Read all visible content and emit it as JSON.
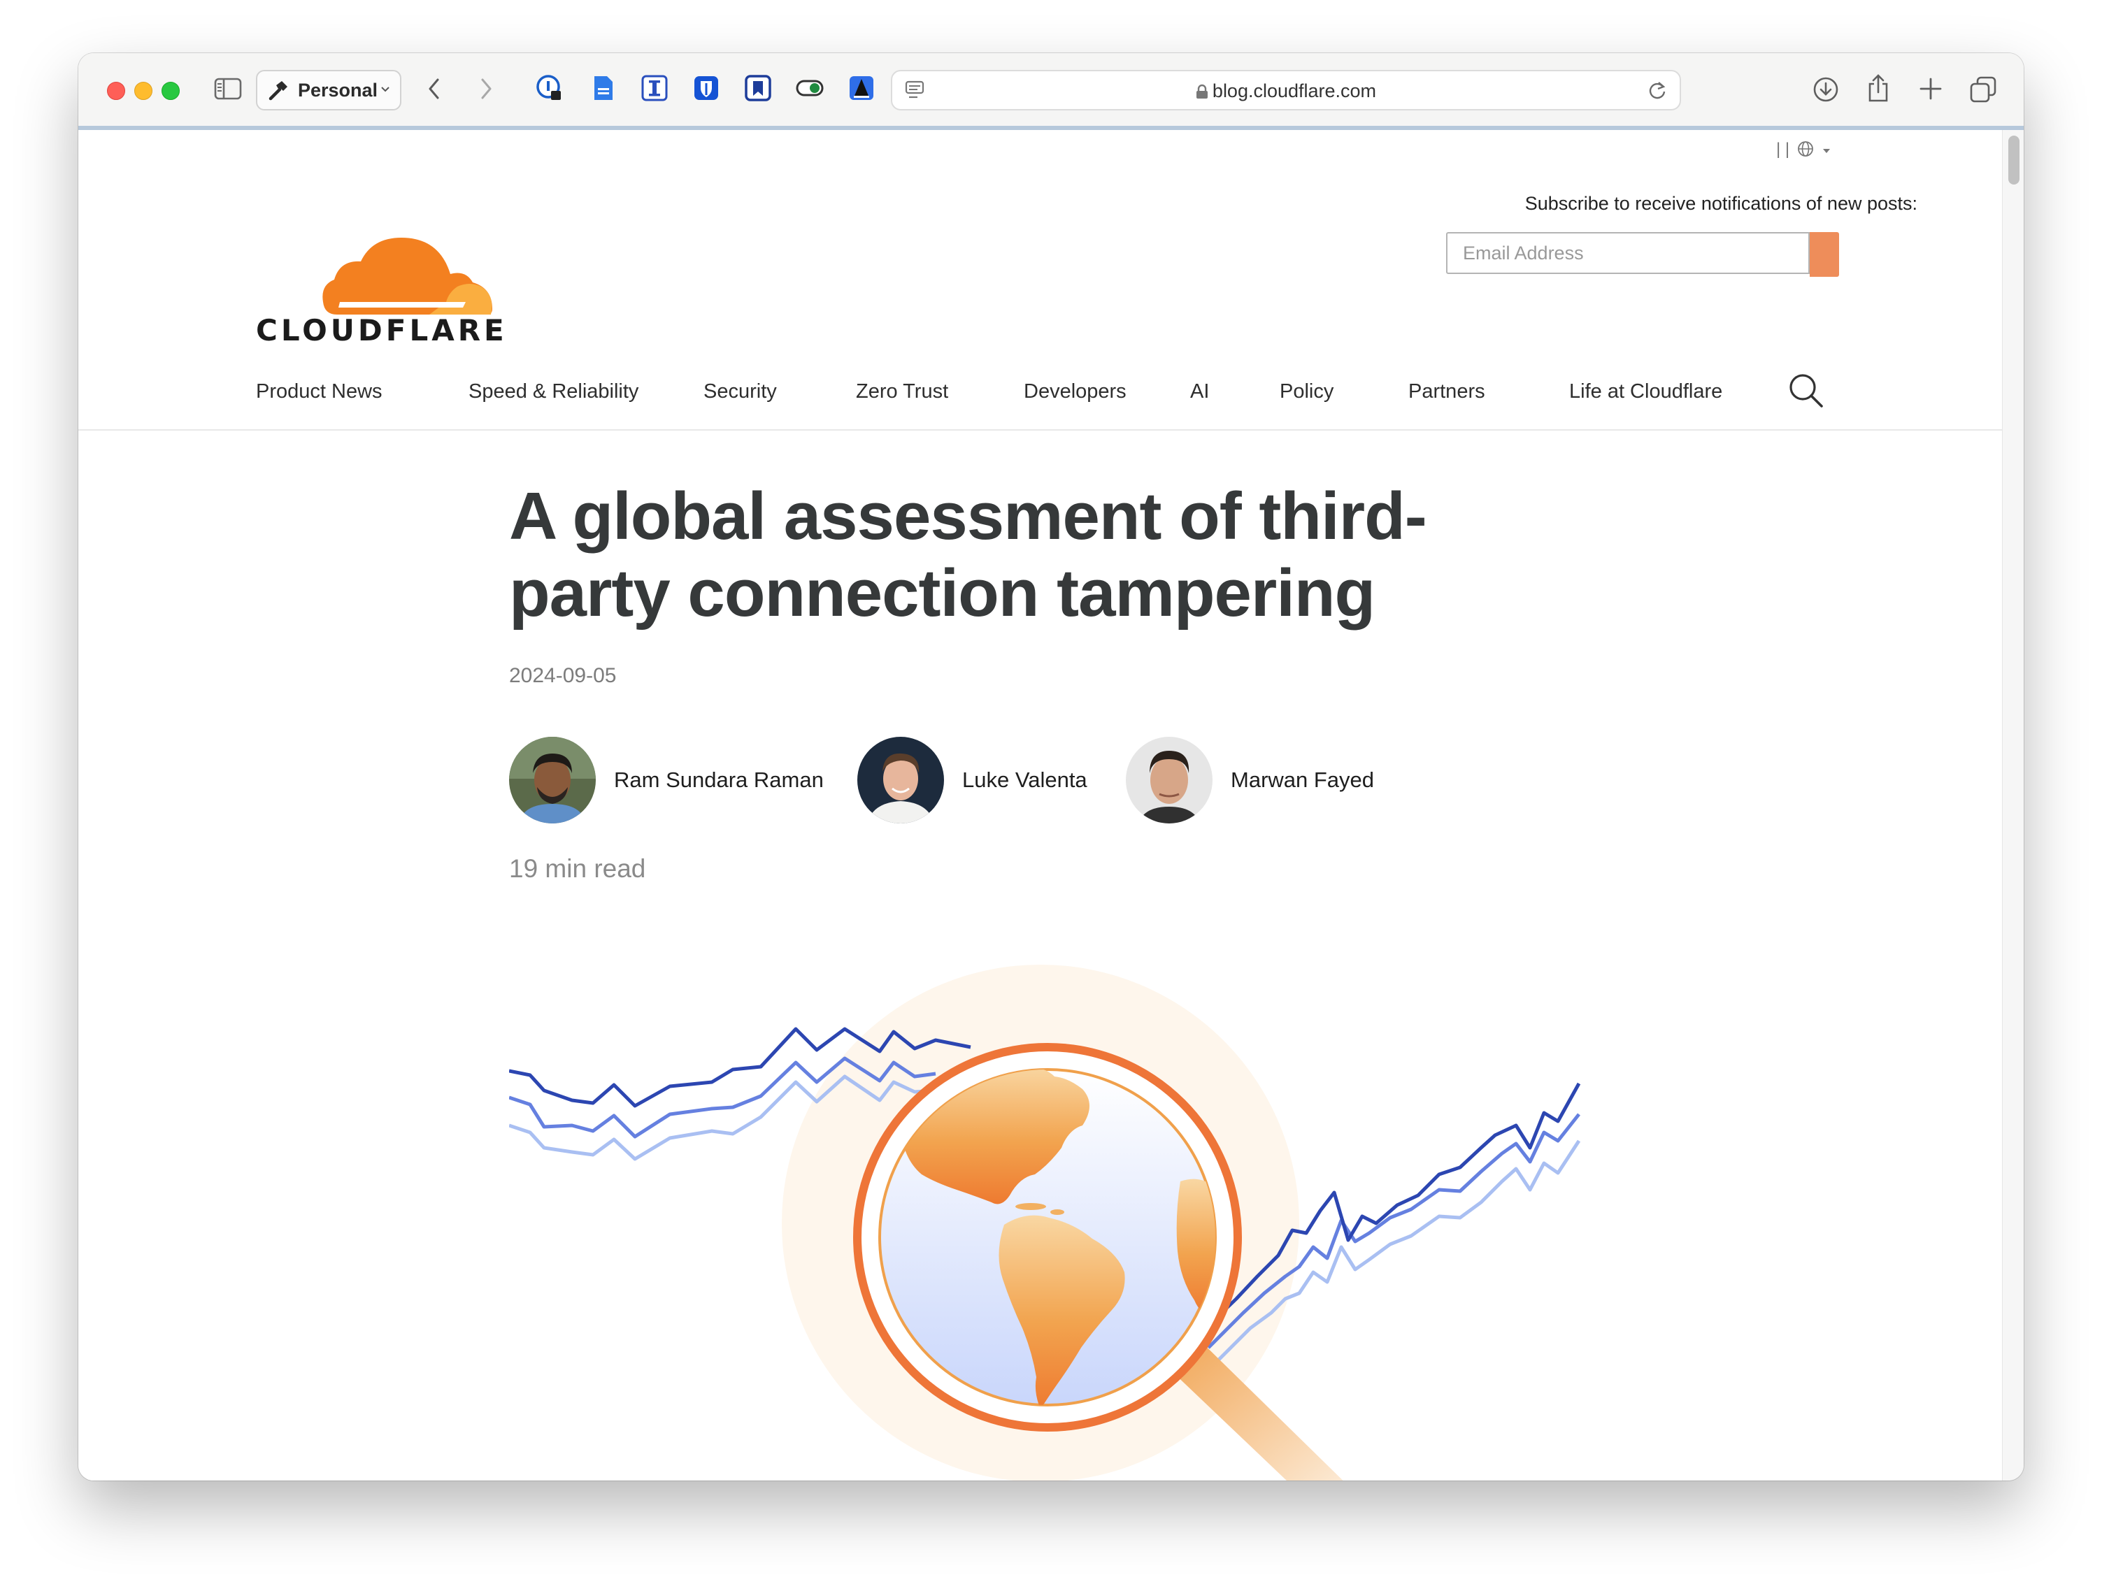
{
  "browser": {
    "profile_label": "Personal",
    "url": "blog.cloudflare.com"
  },
  "header": {
    "logo_text": "CLOUDFLARE",
    "subscribe_label": "Subscribe to receive notifications of new posts:",
    "email_placeholder": "Email Address",
    "lang_separator": "| |"
  },
  "nav": {
    "items": [
      {
        "label": "Product News"
      },
      {
        "label": "Speed & Reliability"
      },
      {
        "label": "Security"
      },
      {
        "label": "Zero Trust"
      },
      {
        "label": "Developers"
      },
      {
        "label": "AI"
      },
      {
        "label": "Policy"
      },
      {
        "label": "Partners"
      },
      {
        "label": "Life at Cloudflare"
      }
    ]
  },
  "article": {
    "title": "A global assessment of third-party connection tampering",
    "date": "2024-09-05",
    "authors": [
      {
        "name": "Ram Sundara Raman"
      },
      {
        "name": "Luke Valenta"
      },
      {
        "name": "Marwan Fayed"
      }
    ],
    "read_time": "19 min read"
  },
  "colors": {
    "brand_orange": "#f38020",
    "subscribe_button": "#ee8d5a",
    "title_text": "#36393a",
    "chart_dark_blue": "#2c46b1",
    "chart_mid_blue": "#6580e0",
    "chart_light_blue": "#a9bff2"
  },
  "icons": [
    "sidebar-icon",
    "hammer-icon",
    "back-arrow-icon",
    "forward-arrow-icon",
    "reader-icon",
    "lock-icon",
    "reload-icon",
    "download-icon",
    "share-icon",
    "new-tab-icon",
    "tabs-overview-icon",
    "globe-icon",
    "search-icon"
  ]
}
